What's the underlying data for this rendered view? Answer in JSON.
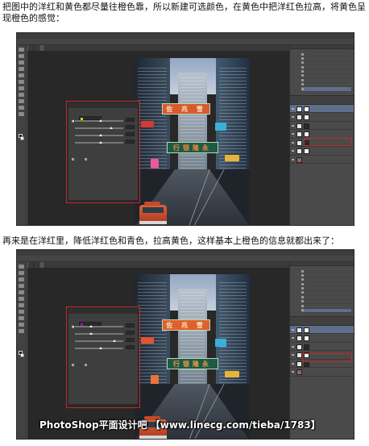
{
  "captions": {
    "first": "把图中的洋红和黄色都尽量往橙色靠，所以新建可选颜色，在黄色中把洋红色拉高，将黄色呈现橙色的感觉：",
    "second": "再来是在洋红里，降低洋红色和青色，拉高黄色，这样基本上橙色的信息就都出来了："
  },
  "screenshots": [
    {
      "selected_color": "yellow",
      "chip_color": "#e8d000",
      "highlighted_layer": "selective-color adjustment layer"
    },
    {
      "selected_color": "magenta",
      "chip_color": "#c000c0",
      "highlighted_layer": "selective-color adjustment layer"
    }
  ],
  "sign_text": {
    "top": "佐 兆 雪",
    "bank": "行银隆永"
  },
  "watermark": "PhotoShop平面设计吧 【www.linecg.com/tieba/1783】",
  "colors": {
    "highlight": "#c62828",
    "ps_background": "#535353",
    "ps_dark": "#282828",
    "layer_selected": "#5d6f8a"
  },
  "icons": [
    "eye-icon",
    "move-tool-icon",
    "foreground-color-swatch",
    "background-color-swatch"
  ]
}
